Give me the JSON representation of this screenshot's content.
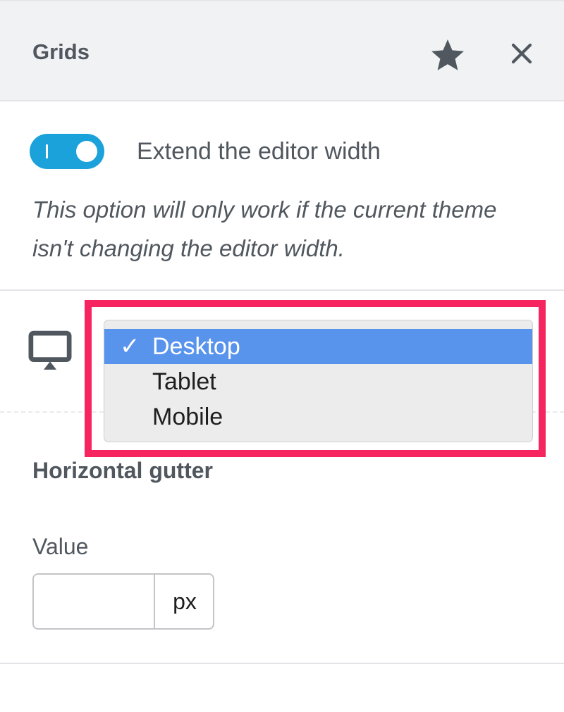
{
  "panel": {
    "title": "Grids",
    "star_icon": "star-icon",
    "close_icon": "close-icon"
  },
  "toggle": {
    "label": "Extend the editor width",
    "checked": true,
    "color": "#1ba2db"
  },
  "help_text": "This option will only work if the current theme isn't changing the editor width.",
  "device_select": {
    "icon": "monitor-icon",
    "selected": "Desktop",
    "check_mark": "✓",
    "options": [
      "Desktop",
      "Tablet",
      "Mobile"
    ],
    "highlight_color": "#f7255f",
    "selected_color": "#5893ec"
  },
  "gutter": {
    "title": "Horizontal gutter",
    "value_label": "Value",
    "value": "",
    "unit": "px"
  }
}
